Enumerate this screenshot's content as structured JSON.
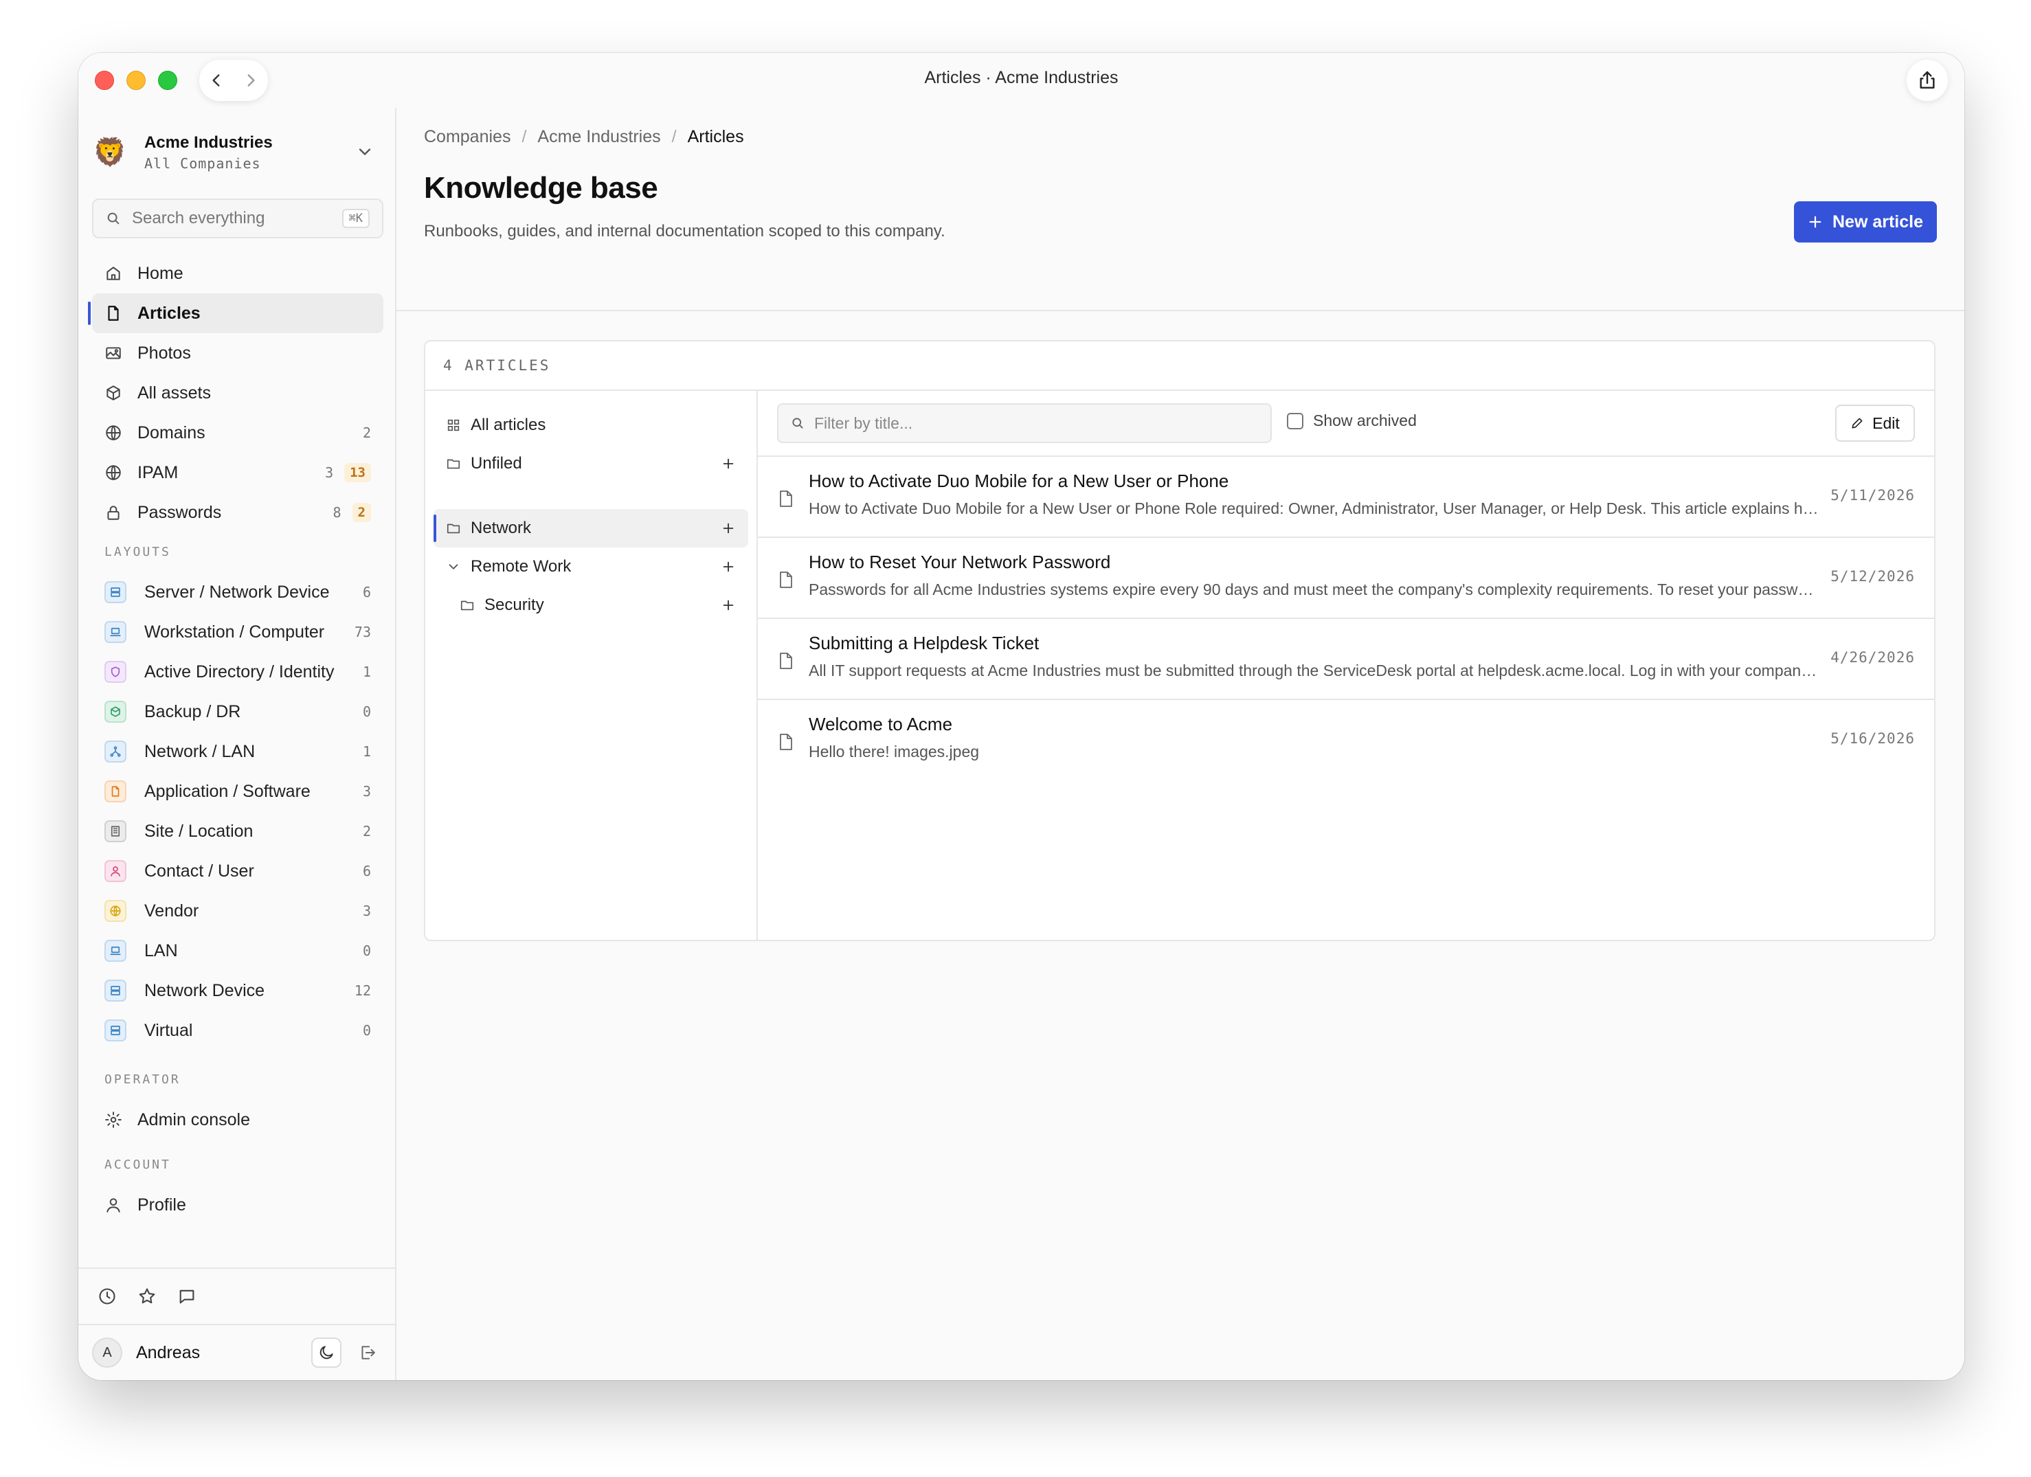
{
  "window": {
    "title": "Articles · Acme Industries"
  },
  "sidebar": {
    "company_name": "Acme Industries",
    "company_sub": "All Companies",
    "search_placeholder": "Search everything",
    "search_shortcut": "⌘K",
    "nav": [
      {
        "label": "Home",
        "icon": "home-icon"
      },
      {
        "label": "Articles",
        "icon": "document-icon",
        "active": true
      },
      {
        "label": "Photos",
        "icon": "image-icon"
      },
      {
        "label": "All assets",
        "icon": "cube-icon"
      },
      {
        "label": "Domains",
        "icon": "globe-icon",
        "count": "2"
      },
      {
        "label": "IPAM",
        "icon": "globe-icon",
        "count": "3",
        "badge": "13"
      },
      {
        "label": "Passwords",
        "icon": "lock-icon",
        "count": "8",
        "badge": "2"
      }
    ],
    "layouts_label": "LAYOUTS",
    "layouts": [
      {
        "label": "Server / Network Device",
        "count": "6",
        "color": "#3b82c4",
        "bg": "#e3effa",
        "icon": "server-icon"
      },
      {
        "label": "Workstation / Computer",
        "count": "73",
        "color": "#3b82c4",
        "bg": "#e3effa",
        "icon": "laptop-icon"
      },
      {
        "label": "Active Directory / Identity",
        "count": "1",
        "color": "#a855d8",
        "bg": "#f3e8fb",
        "icon": "shield-icon"
      },
      {
        "label": "Backup / DR",
        "count": "0",
        "color": "#2f9e6a",
        "bg": "#def3e8",
        "icon": "box-icon"
      },
      {
        "label": "Network / LAN",
        "count": "1",
        "color": "#3b82c4",
        "bg": "#e3effa",
        "icon": "network-icon"
      },
      {
        "label": "Application / Software",
        "count": "3",
        "color": "#e07a1f",
        "bg": "#fdecd9",
        "icon": "file-icon"
      },
      {
        "label": "Site / Location",
        "count": "2",
        "color": "#666666",
        "bg": "#ececec",
        "icon": "building-icon"
      },
      {
        "label": "Contact / User",
        "count": "6",
        "color": "#d6457c",
        "bg": "#fbe4ed",
        "icon": "user-icon"
      },
      {
        "label": "Vendor",
        "count": "3",
        "color": "#d9a514",
        "bg": "#fcf3d6",
        "icon": "globe-icon"
      },
      {
        "label": "LAN",
        "count": "0",
        "color": "#3b82c4",
        "bg": "#e3effa",
        "icon": "laptop-icon"
      },
      {
        "label": "Network Device",
        "count": "12",
        "color": "#3b82c4",
        "bg": "#e3effa",
        "icon": "server-icon"
      },
      {
        "label": "Virtual",
        "count": "0",
        "color": "#3b82c4",
        "bg": "#e3effa",
        "icon": "server-icon"
      }
    ],
    "operator_label": "OPERATOR",
    "admin_console": "Admin console",
    "account_label": "ACCOUNT",
    "profile": "Profile",
    "user_initial": "A",
    "user_name": "Andreas"
  },
  "main": {
    "breadcrumb": [
      "Companies",
      "Acme Industries",
      "Articles"
    ],
    "title": "Knowledge base",
    "subtitle": "Runbooks, guides, and internal documentation scoped to this company.",
    "new_button": "New article",
    "panel_header": "4 ARTICLES",
    "tree": {
      "all_articles": "All articles",
      "unfiled": "Unfiled",
      "folders": [
        {
          "label": "Network",
          "selected": true,
          "depth": 0
        },
        {
          "label": "Remote Work",
          "expanded": true,
          "depth": 0
        },
        {
          "label": "Security",
          "depth": 1
        }
      ]
    },
    "filter_placeholder": "Filter by title...",
    "show_archived": "Show archived",
    "edit_button": "Edit",
    "articles": [
      {
        "title": "How to Activate Duo Mobile for a New User or Phone",
        "excerpt": "How to Activate Duo Mobile for a New User or Phone Role required: Owner, Administrator, User Manager, or Help Desk. This article explains how to a.",
        "date": "5/11/2026"
      },
      {
        "title": "How to Reset Your Network Password",
        "excerpt": "Passwords for all Acme Industries systems expire every 90 days and must meet the company's complexity requirements. To reset your password, n...",
        "date": "5/12/2026"
      },
      {
        "title": "Submitting a Helpdesk Ticket",
        "excerpt": "All IT support requests at Acme Industries must be submitted through the ServiceDesk portal at helpdesk.acme.local. Log in with your company cre...",
        "date": "4/26/2026"
      },
      {
        "title": "Welcome to Acme",
        "excerpt": "Hello there! images.jpeg",
        "date": "5/16/2026"
      }
    ]
  }
}
